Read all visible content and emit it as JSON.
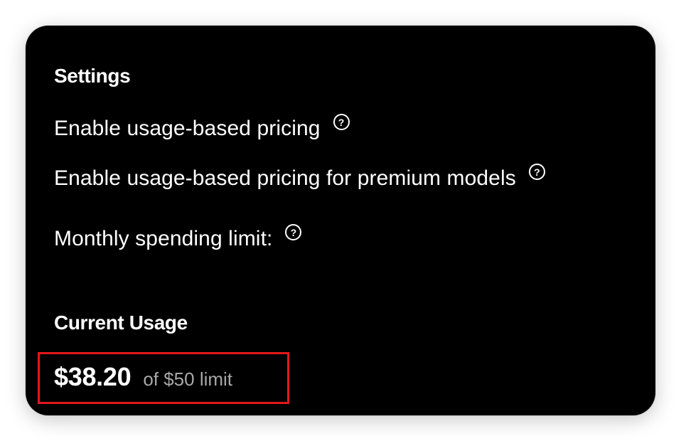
{
  "settings": {
    "title": "Settings",
    "rows": [
      {
        "label": "Enable usage-based pricing",
        "help": "?"
      },
      {
        "label": "Enable usage-based pricing for premium models",
        "help": "?"
      },
      {
        "label": "Monthly spending limit:",
        "help": "?"
      }
    ]
  },
  "usage": {
    "title": "Current Usage",
    "amount": "$38.20",
    "limit_text": "of $50 limit",
    "spent": 38.2,
    "limit": 50
  },
  "colors": {
    "card_background": "#000000",
    "highlight_border": "#e3181b",
    "muted_text": "#a8a8a8"
  }
}
